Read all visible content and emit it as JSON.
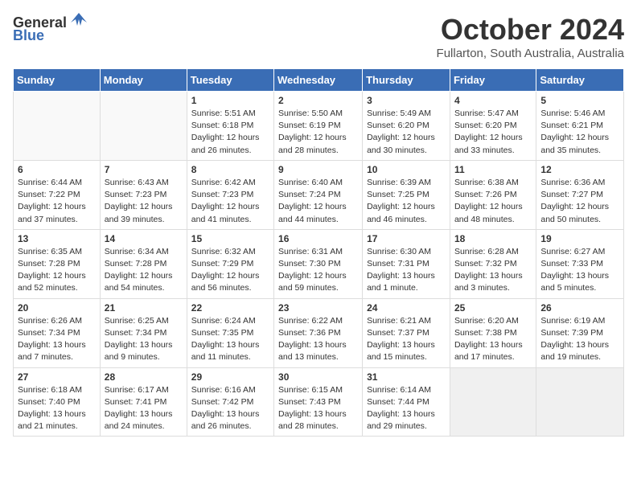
{
  "logo": {
    "general": "General",
    "blue": "Blue"
  },
  "title": "October 2024",
  "location": "Fullarton, South Australia, Australia",
  "days_of_week": [
    "Sunday",
    "Monday",
    "Tuesday",
    "Wednesday",
    "Thursday",
    "Friday",
    "Saturday"
  ],
  "weeks": [
    [
      {
        "day": "",
        "info": ""
      },
      {
        "day": "",
        "info": ""
      },
      {
        "day": "1",
        "info": "Sunrise: 5:51 AM\nSunset: 6:18 PM\nDaylight: 12 hours\nand 26 minutes."
      },
      {
        "day": "2",
        "info": "Sunrise: 5:50 AM\nSunset: 6:19 PM\nDaylight: 12 hours\nand 28 minutes."
      },
      {
        "day": "3",
        "info": "Sunrise: 5:49 AM\nSunset: 6:20 PM\nDaylight: 12 hours\nand 30 minutes."
      },
      {
        "day": "4",
        "info": "Sunrise: 5:47 AM\nSunset: 6:20 PM\nDaylight: 12 hours\nand 33 minutes."
      },
      {
        "day": "5",
        "info": "Sunrise: 5:46 AM\nSunset: 6:21 PM\nDaylight: 12 hours\nand 35 minutes."
      }
    ],
    [
      {
        "day": "6",
        "info": "Sunrise: 6:44 AM\nSunset: 7:22 PM\nDaylight: 12 hours\nand 37 minutes."
      },
      {
        "day": "7",
        "info": "Sunrise: 6:43 AM\nSunset: 7:23 PM\nDaylight: 12 hours\nand 39 minutes."
      },
      {
        "day": "8",
        "info": "Sunrise: 6:42 AM\nSunset: 7:23 PM\nDaylight: 12 hours\nand 41 minutes."
      },
      {
        "day": "9",
        "info": "Sunrise: 6:40 AM\nSunset: 7:24 PM\nDaylight: 12 hours\nand 44 minutes."
      },
      {
        "day": "10",
        "info": "Sunrise: 6:39 AM\nSunset: 7:25 PM\nDaylight: 12 hours\nand 46 minutes."
      },
      {
        "day": "11",
        "info": "Sunrise: 6:38 AM\nSunset: 7:26 PM\nDaylight: 12 hours\nand 48 minutes."
      },
      {
        "day": "12",
        "info": "Sunrise: 6:36 AM\nSunset: 7:27 PM\nDaylight: 12 hours\nand 50 minutes."
      }
    ],
    [
      {
        "day": "13",
        "info": "Sunrise: 6:35 AM\nSunset: 7:28 PM\nDaylight: 12 hours\nand 52 minutes."
      },
      {
        "day": "14",
        "info": "Sunrise: 6:34 AM\nSunset: 7:28 PM\nDaylight: 12 hours\nand 54 minutes."
      },
      {
        "day": "15",
        "info": "Sunrise: 6:32 AM\nSunset: 7:29 PM\nDaylight: 12 hours\nand 56 minutes."
      },
      {
        "day": "16",
        "info": "Sunrise: 6:31 AM\nSunset: 7:30 PM\nDaylight: 12 hours\nand 59 minutes."
      },
      {
        "day": "17",
        "info": "Sunrise: 6:30 AM\nSunset: 7:31 PM\nDaylight: 13 hours\nand 1 minute."
      },
      {
        "day": "18",
        "info": "Sunrise: 6:28 AM\nSunset: 7:32 PM\nDaylight: 13 hours\nand 3 minutes."
      },
      {
        "day": "19",
        "info": "Sunrise: 6:27 AM\nSunset: 7:33 PM\nDaylight: 13 hours\nand 5 minutes."
      }
    ],
    [
      {
        "day": "20",
        "info": "Sunrise: 6:26 AM\nSunset: 7:34 PM\nDaylight: 13 hours\nand 7 minutes."
      },
      {
        "day": "21",
        "info": "Sunrise: 6:25 AM\nSunset: 7:34 PM\nDaylight: 13 hours\nand 9 minutes."
      },
      {
        "day": "22",
        "info": "Sunrise: 6:24 AM\nSunset: 7:35 PM\nDaylight: 13 hours\nand 11 minutes."
      },
      {
        "day": "23",
        "info": "Sunrise: 6:22 AM\nSunset: 7:36 PM\nDaylight: 13 hours\nand 13 minutes."
      },
      {
        "day": "24",
        "info": "Sunrise: 6:21 AM\nSunset: 7:37 PM\nDaylight: 13 hours\nand 15 minutes."
      },
      {
        "day": "25",
        "info": "Sunrise: 6:20 AM\nSunset: 7:38 PM\nDaylight: 13 hours\nand 17 minutes."
      },
      {
        "day": "26",
        "info": "Sunrise: 6:19 AM\nSunset: 7:39 PM\nDaylight: 13 hours\nand 19 minutes."
      }
    ],
    [
      {
        "day": "27",
        "info": "Sunrise: 6:18 AM\nSunset: 7:40 PM\nDaylight: 13 hours\nand 21 minutes."
      },
      {
        "day": "28",
        "info": "Sunrise: 6:17 AM\nSunset: 7:41 PM\nDaylight: 13 hours\nand 24 minutes."
      },
      {
        "day": "29",
        "info": "Sunrise: 6:16 AM\nSunset: 7:42 PM\nDaylight: 13 hours\nand 26 minutes."
      },
      {
        "day": "30",
        "info": "Sunrise: 6:15 AM\nSunset: 7:43 PM\nDaylight: 13 hours\nand 28 minutes."
      },
      {
        "day": "31",
        "info": "Sunrise: 6:14 AM\nSunset: 7:44 PM\nDaylight: 13 hours\nand 29 minutes."
      },
      {
        "day": "",
        "info": ""
      },
      {
        "day": "",
        "info": ""
      }
    ]
  ]
}
